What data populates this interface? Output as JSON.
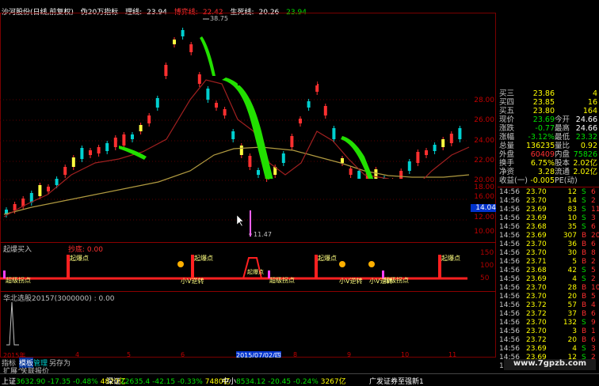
{
  "title_bar": {
    "stock": "沙河股份(日线,前复权)",
    "indicator": "伪20万指标",
    "line1_label": "理线:",
    "line1_value": "23.94",
    "line2_label": "博弈线:",
    "line2_value": "22.42",
    "line3_label": "生死线:",
    "line3_value": "20.26",
    "line4_value": "23.94"
  },
  "price_axis": [
    "28.00",
    "26.00",
    "24.00",
    "22.00",
    "20.00",
    "18.00",
    "16.00",
    "14.00",
    "12.00",
    "10.00"
  ],
  "highlight_price": "14.04",
  "annotations": {
    "high": "38.75",
    "low": "11.47"
  },
  "panel2": {
    "title": "起爆买入",
    "subtitle": "抄底: 0.00",
    "labels": [
      "起爆点",
      "起爆点",
      "起爆点",
      "起爆点",
      "起爆点"
    ],
    "low_labels": [
      "超级拐点",
      "小V逆转",
      "超级拐点",
      "小V逆转",
      "小V逆转",
      "超级拐点"
    ],
    "axis": [
      "150",
      "100",
      "50"
    ]
  },
  "panel3": {
    "title": "华北选股20157(3000000) : 0.00"
  },
  "x_axis": {
    "dates": [
      "2015年",
      "4",
      "5",
      "6",
      "2015/07/02/四",
      "8",
      "9",
      "10",
      "11"
    ]
  },
  "tabs": [
    "指标",
    "模板",
    "管理",
    "另存为"
  ],
  "tabs2": [
    "扩展^",
    "关联报价"
  ],
  "quote": {
    "rows": [
      {
        "l": "买三",
        "v1": "23.86",
        "c1": "#ffff00",
        "l2": "",
        "v2": "4",
        "c2": "#ffff00"
      },
      {
        "l": "买四",
        "v1": "23.85",
        "c1": "#ffff00",
        "l2": "",
        "v2": "16",
        "c2": "#ffff00"
      },
      {
        "l": "买五",
        "v1": "23.80",
        "c1": "#ffff00",
        "l2": "",
        "v2": "164",
        "c2": "#ffff00"
      },
      {
        "l": "现价",
        "v1": "23.69",
        "c1": "#00e000",
        "l2": "今开",
        "v2": "24.66",
        "c2": "#ffffff"
      },
      {
        "l": "涨跌",
        "v1": "-0.77",
        "c1": "#00e000",
        "l2": "最高",
        "v2": "24.66",
        "c2": "#ffffff"
      },
      {
        "l": "涨幅",
        "v1": "-3.12%",
        "c1": "#00e000",
        "l2": "最低",
        "v2": "23.32",
        "c2": "#00e000"
      },
      {
        "l": "总量",
        "v1": "136235",
        "c1": "#ffff00",
        "l2": "量比",
        "v2": "0.92",
        "c2": "#ffff00"
      },
      {
        "l": "外盘",
        "v1": "60409",
        "c1": "#ff3030",
        "l2": "内盘",
        "v2": "75826",
        "c2": "#00e000"
      },
      {
        "l": "换手",
        "v1": "6.75%",
        "c1": "#ffff00",
        "l2": "股本",
        "v2": "2.02亿",
        "c2": "#ffff00"
      },
      {
        "l": "净资",
        "v1": "3.28",
        "c1": "#ffff00",
        "l2": "流通",
        "v2": "2.02亿",
        "c2": "#ffff00"
      },
      {
        "l": "收益(一)",
        "v1": "-0.005",
        "c1": "#ffff00",
        "l2": "PE(动)",
        "v2": "",
        "c2": "#ffff00"
      }
    ],
    "ticks": [
      {
        "t": "14:56",
        "p": "23.70",
        "q": "12",
        "s": "S",
        "sc": "#00e000",
        "a": "6",
        "ac": "#ff3030"
      },
      {
        "t": "14:56",
        "p": "23.70",
        "q": "14",
        "s": "S",
        "sc": "#00e000",
        "a": "2",
        "ac": "#ff3030"
      },
      {
        "t": "14:56",
        "p": "23.69",
        "q": "83",
        "s": "S",
        "sc": "#00e000",
        "a": "11",
        "ac": "#ff3030"
      },
      {
        "t": "14:56",
        "p": "23.69",
        "q": "10",
        "s": "S",
        "sc": "#00e000",
        "a": "3",
        "ac": "#ff3030"
      },
      {
        "t": "14:56",
        "p": "23.68",
        "q": "35",
        "s": "S",
        "sc": "#00e000",
        "a": "6",
        "ac": "#ff3030"
      },
      {
        "t": "14:56",
        "p": "23.69",
        "q": "307",
        "s": "B",
        "sc": "#ff3030",
        "a": "20",
        "ac": "#ff3030"
      },
      {
        "t": "14:56",
        "p": "23.70",
        "q": "36",
        "s": "B",
        "sc": "#ff3030",
        "a": "6",
        "ac": "#ff3030"
      },
      {
        "t": "14:56",
        "p": "23.70",
        "q": "30",
        "s": "B",
        "sc": "#ff3030",
        "a": "8",
        "ac": "#ff3030"
      },
      {
        "t": "14:56",
        "p": "23.71",
        "q": "5",
        "s": "B",
        "sc": "#ff3030",
        "a": "2",
        "ac": "#ff3030"
      },
      {
        "t": "14:56",
        "p": "23.68",
        "q": "42",
        "s": "S",
        "sc": "#00e000",
        "a": "5",
        "ac": "#ff3030"
      },
      {
        "t": "14:56",
        "p": "23.69",
        "q": "4",
        "s": "S",
        "sc": "#00e000",
        "a": "2",
        "ac": "#ff3030"
      },
      {
        "t": "14:56",
        "p": "23.70",
        "q": "28",
        "s": "B",
        "sc": "#ff3030",
        "a": "10",
        "ac": "#ff3030"
      },
      {
        "t": "14:56",
        "p": "23.70",
        "q": "20",
        "s": "B",
        "sc": "#ff3030",
        "a": "5",
        "ac": "#ff3030"
      },
      {
        "t": "14:56",
        "p": "23.72",
        "q": "57",
        "s": "B",
        "sc": "#ff3030",
        "a": "4",
        "ac": "#ff3030"
      },
      {
        "t": "14:56",
        "p": "23.72",
        "q": "37",
        "s": "B",
        "sc": "#ff3030",
        "a": "6",
        "ac": "#ff3030"
      },
      {
        "t": "14:56",
        "p": "23.70",
        "q": "132",
        "s": "S",
        "sc": "#00e000",
        "a": "9",
        "ac": "#ff3030"
      },
      {
        "t": "14:56",
        "p": "23.70",
        "q": "3",
        "s": "B",
        "sc": "#ff3030",
        "a": "1",
        "ac": "#ff3030"
      },
      {
        "t": "14:56",
        "p": "23.72",
        "q": "20",
        "s": "B",
        "sc": "#ff3030",
        "a": "6",
        "ac": "#ff3030"
      },
      {
        "t": "14:56",
        "p": "23.69",
        "q": "4",
        "s": "S",
        "sc": "#00e000",
        "a": "3",
        "ac": "#ff3030"
      },
      {
        "t": "14:56",
        "p": "23.69",
        "q": "12",
        "s": "S",
        "sc": "#00e000",
        "a": "2",
        "ac": "#ff3030"
      },
      {
        "t": "14:56",
        "p": "23.69",
        "q": "8",
        "s": "S",
        "sc": "#00e000",
        "a": "1",
        "ac": "#ff3030"
      }
    ]
  },
  "status": {
    "sh_label": "上证",
    "sh_val": "3632.90",
    "sh_chg": "-17.35",
    "sh_pct": "-0.48%",
    "sh_amt": "4820亿",
    "sz_label": "深证",
    "sz_val": "12635.4",
    "sz_chg": "-42.15",
    "sz_pct": "-0.33%",
    "sz_amt": "7480亿",
    "zx_label": "中小",
    "zx_val": "8534.12",
    "zx_chg": "-20.45",
    "zx_pct": "-0.24%",
    "zx_amt": "3267亿",
    "broker": "广发证券至强新1"
  },
  "watermark": "www.7gpzb.com"
}
